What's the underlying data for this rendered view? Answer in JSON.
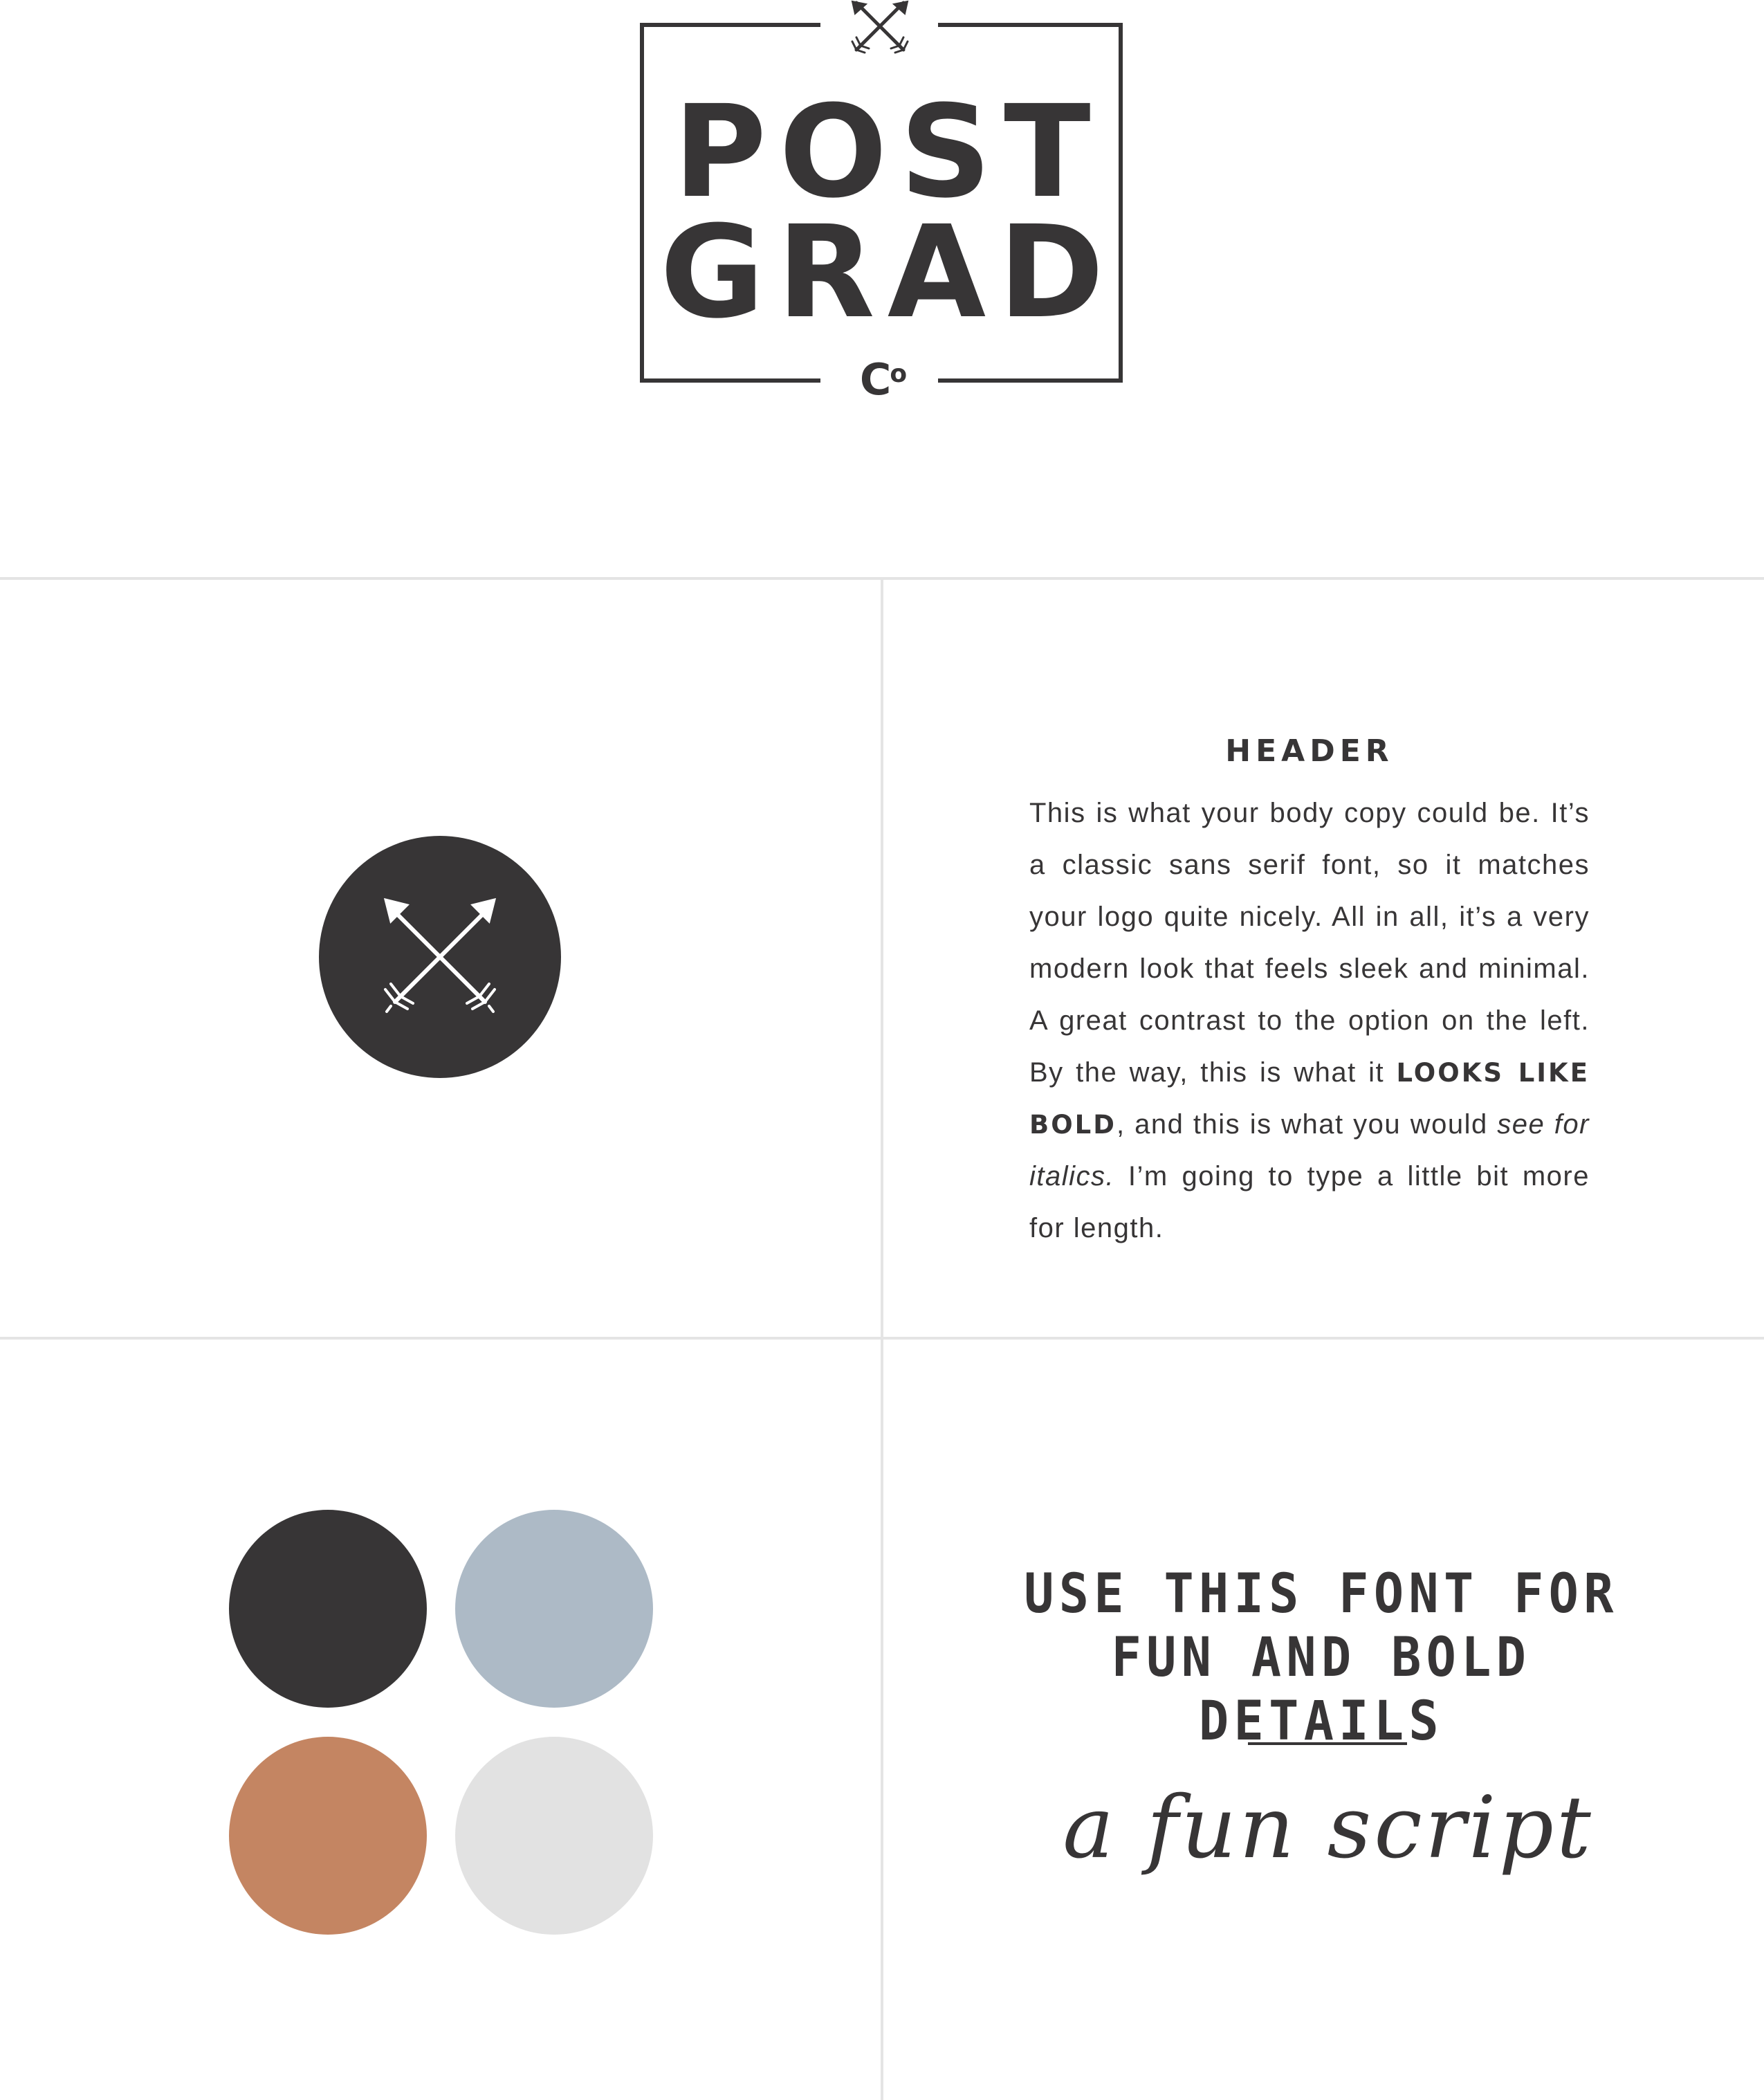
{
  "logo": {
    "line1": "POST",
    "line2": "GRAD",
    "co": "C",
    "co_super": "o"
  },
  "copy_panel": {
    "header": "HEADER",
    "body_part1": "This is what your body copy could be. It’s a classic sans serif font, so it matches your logo quite nicely. All in all, it’s a very modern look that feels sleek and minimal. A great contrast to the option on the left. By the way, this is what it ",
    "bold_text": "LOOKS LIKE BOLD",
    "body_part2": ", and this is what you would ",
    "italic_text": "see for italics.",
    "body_part3": " I’m going to type a little bit more for length."
  },
  "palette": {
    "swatches": [
      {
        "name": "charcoal",
        "color": "#373536"
      },
      {
        "name": "dusty-blue",
        "color": "#adbac6"
      },
      {
        "name": "terracotta",
        "color": "#c48562"
      },
      {
        "name": "light-gray",
        "color": "#e2e2e2"
      }
    ]
  },
  "display_font": {
    "line1": "USE THIS FONT FOR",
    "line2": "FUN AND BOLD DETAILS"
  },
  "script_font": {
    "sample": "a fun script"
  },
  "icons": {
    "logo_mark": "crossed-arrows-icon",
    "badge": "crossed-arrows-icon"
  },
  "colors": {
    "ink": "#373536",
    "rule": "#e4e4e4",
    "background": "#ffffff"
  }
}
